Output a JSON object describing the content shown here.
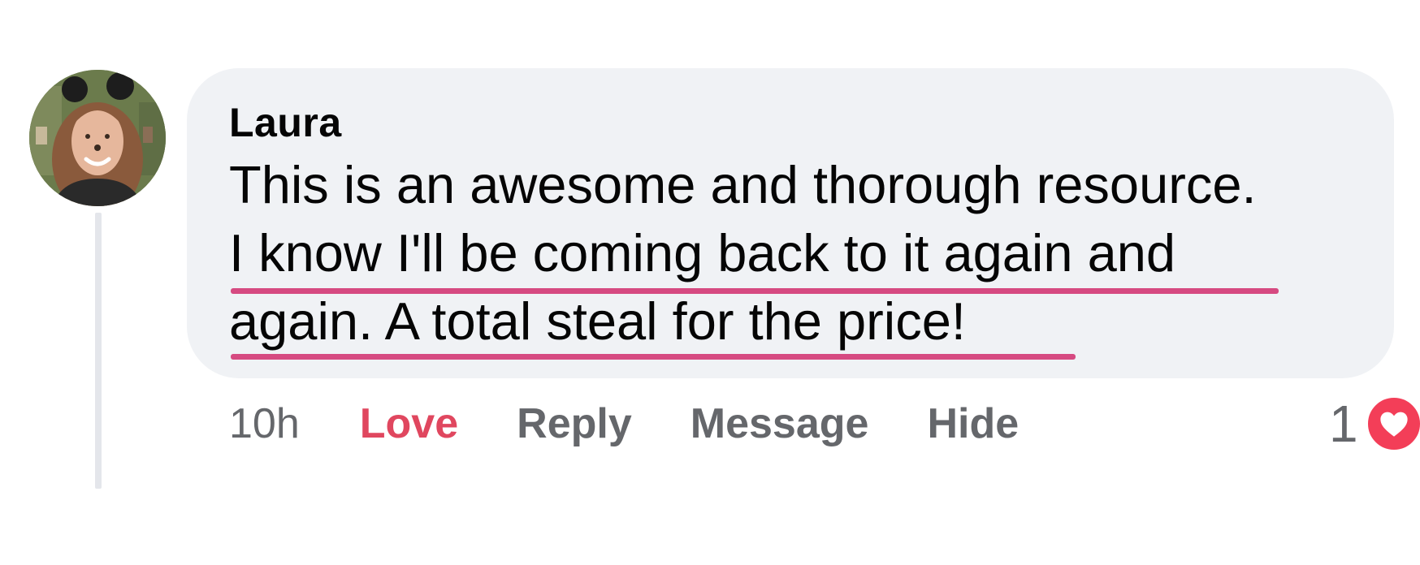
{
  "comment": {
    "author": "Laura",
    "text_lines": [
      "This is an awesome and thorough resource.",
      "I know I'll be coming back to it again and",
      "again. A total steal for the price!"
    ],
    "timestamp": "10h",
    "actions": {
      "love_label": "Love",
      "reply_label": "Reply",
      "message_label": "Message",
      "hide_label": "Hide"
    },
    "reactions": {
      "count": "1",
      "icon": "heart-icon"
    },
    "colors": {
      "bubble": "#f0f2f5",
      "love_active": "#e0475f",
      "underline": "#d64a81",
      "muted_text": "#65676b",
      "heart_badge": "#f33e58"
    }
  }
}
